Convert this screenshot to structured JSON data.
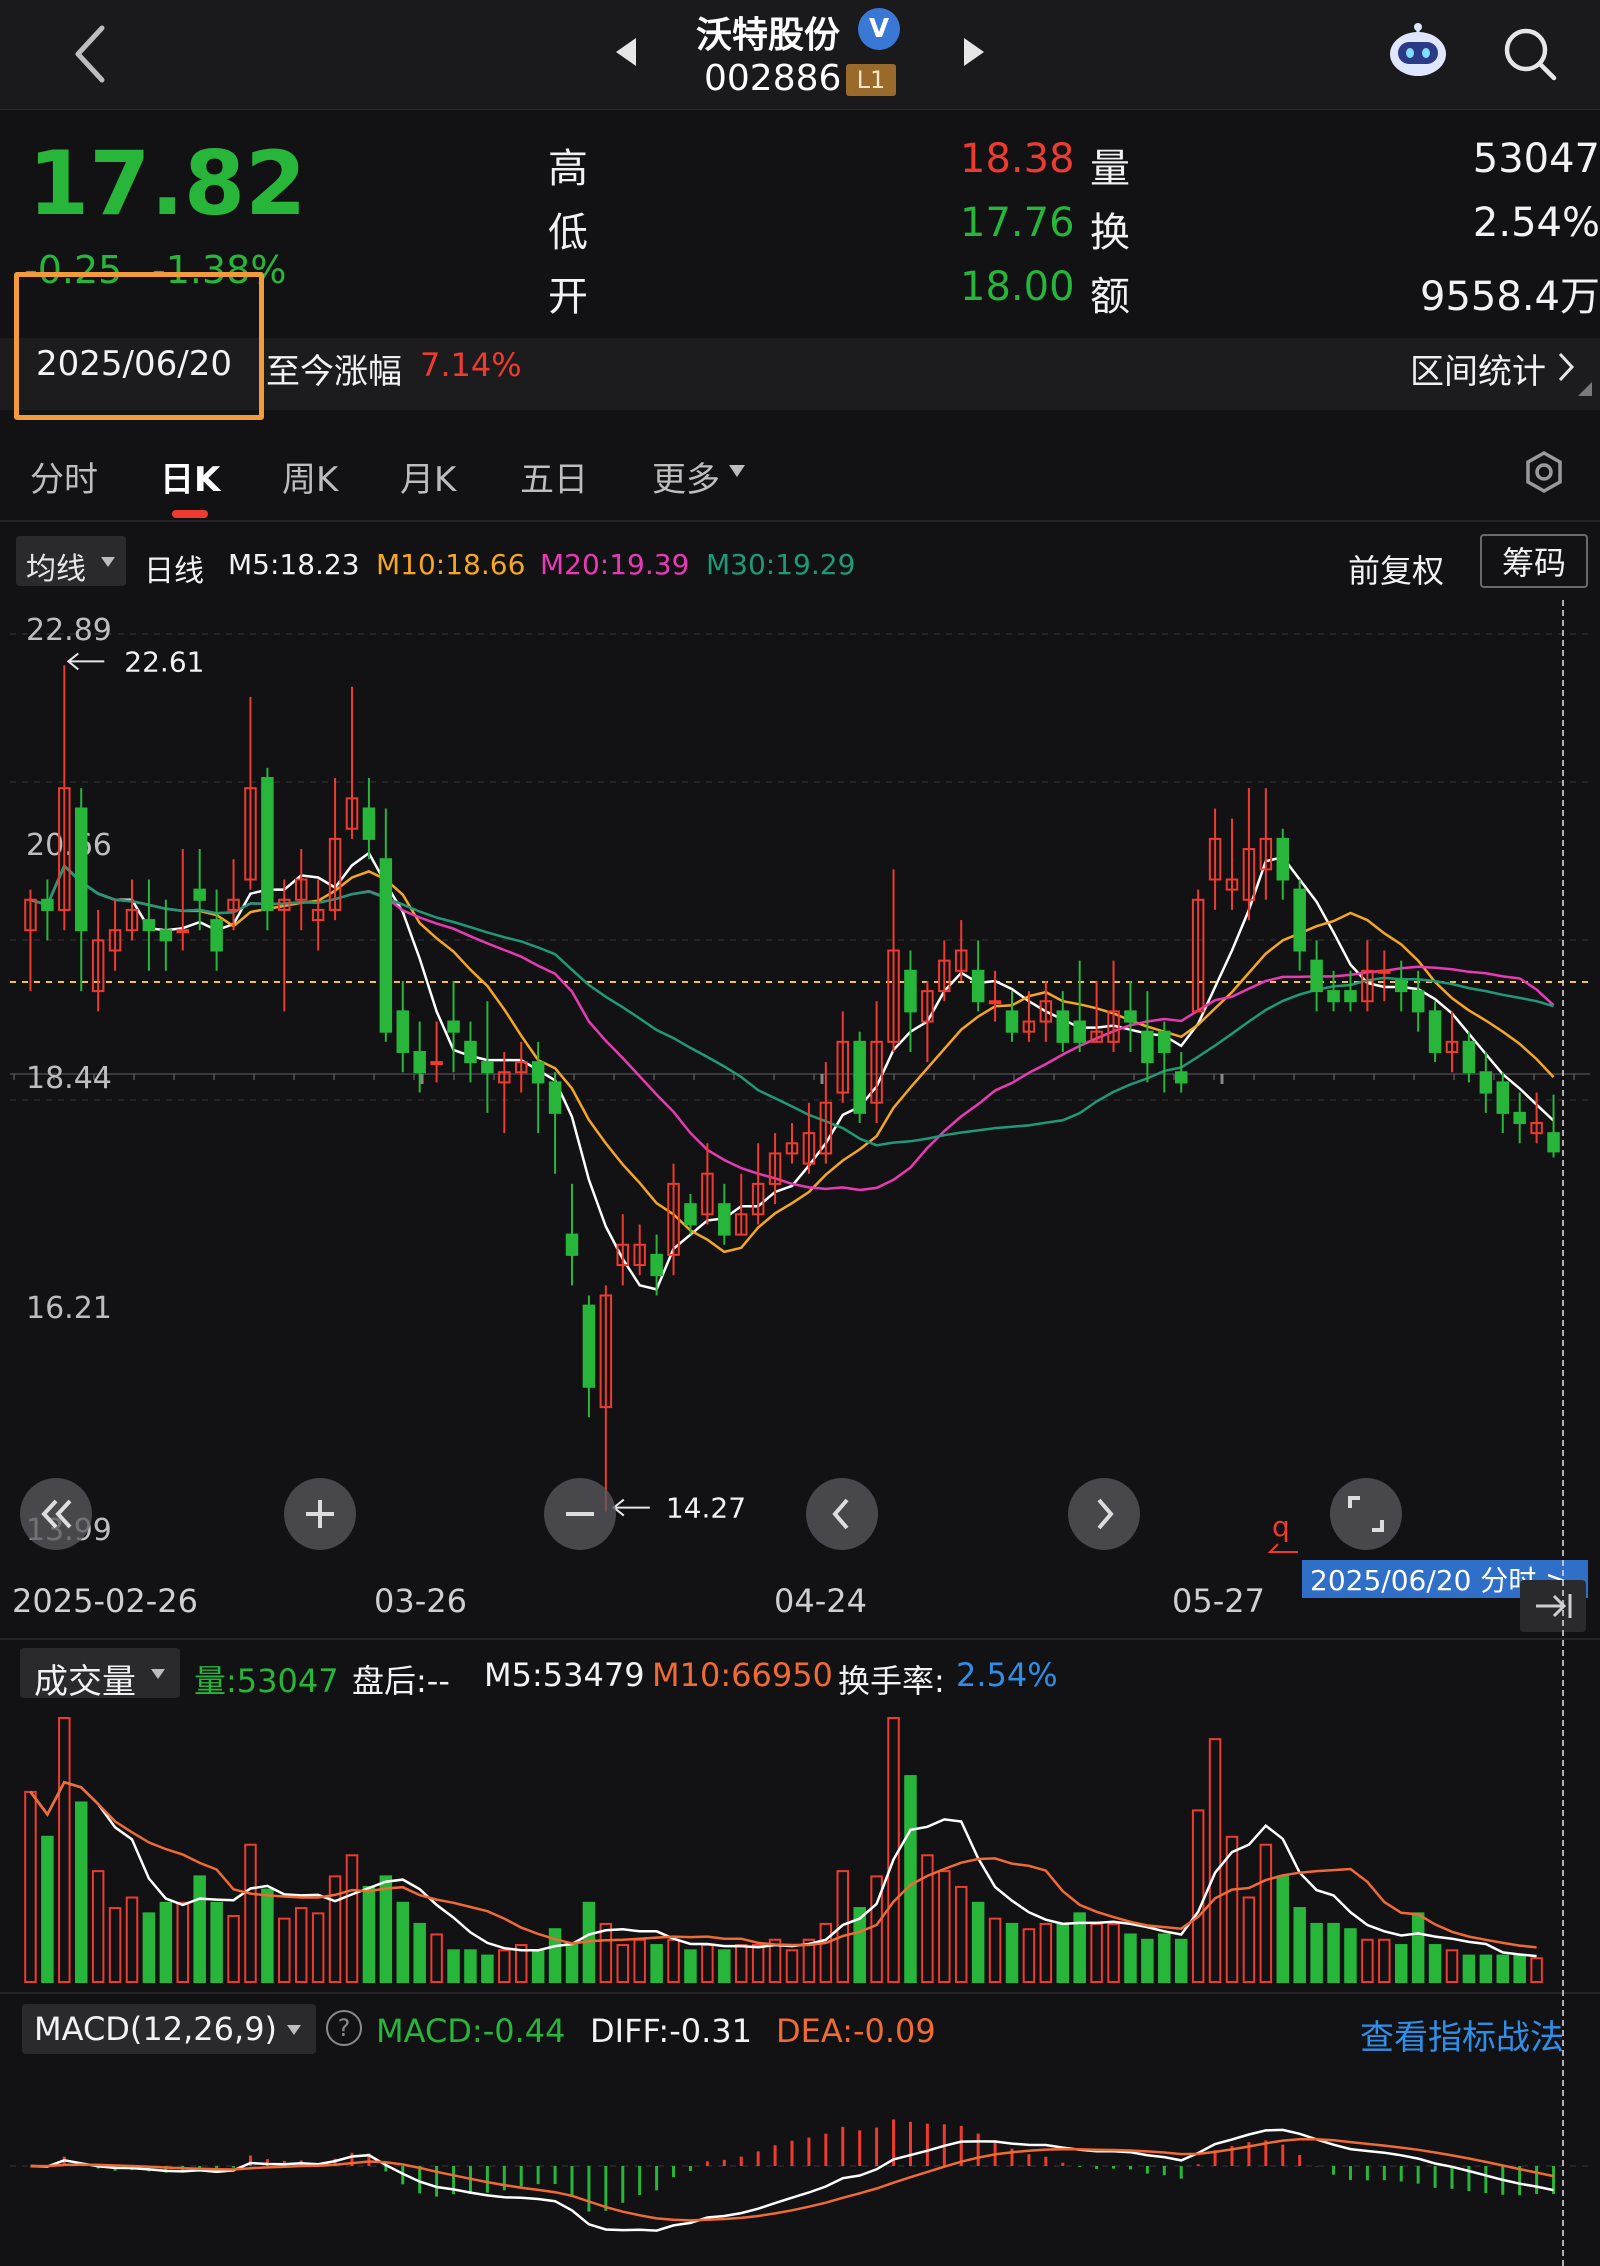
{
  "header": {
    "stock_name": "沃特股份",
    "verified_badge": "V",
    "stock_code": "002886",
    "level_badge": "L1"
  },
  "quote": {
    "price": "17.82",
    "change": "-0.25",
    "change_pct": "-1.38%",
    "high_label": "高",
    "high_value": "18.38",
    "low_label": "低",
    "low_value": "17.76",
    "open_label": "开",
    "open_value": "18.00",
    "volume_label": "量",
    "volume_value": "53047",
    "turnover_label": "换",
    "turnover_value": "2.54%",
    "amount_label": "额",
    "amount_value": "9558.4万"
  },
  "range_bar": {
    "date": "2025/06/20",
    "since_label": "至今涨幅",
    "since_value": "7.14%",
    "stats_label": "区间统计"
  },
  "tabs": [
    {
      "label": "分时"
    },
    {
      "label": "日K"
    },
    {
      "label": "周K"
    },
    {
      "label": "月K"
    },
    {
      "label": "五日"
    },
    {
      "label": "更多"
    }
  ],
  "ma_bar": {
    "selector": "均线",
    "period": "日线",
    "m5": "M5:18.23",
    "m10": "M10:18.66",
    "m20": "M20:19.39",
    "m30": "M30:19.29",
    "adjust": "前复权",
    "chips": "筹码"
  },
  "kline": {
    "price_labels": [
      "22.89",
      "20.66",
      "18.44",
      "16.21",
      "13.99"
    ],
    "max_marker": "22.61",
    "min_marker": "14.27",
    "date_labels": [
      "2025-02-26",
      "03-26",
      "04-24",
      "05-27"
    ],
    "cursor_label": "2025/06/20  分时  >",
    "q_marker": "q"
  },
  "volume_bar": {
    "selector": "成交量",
    "vol": "量:53047",
    "after_hours": "盘后:--",
    "m5": "M5:53479",
    "m10": "M10:66950",
    "turnover": "换手率:",
    "turnover_value": "2.54%"
  },
  "macd_bar": {
    "selector": "MACD(12,26,9)",
    "help": "?",
    "macd": "MACD:-0.44",
    "diff": "DIFF:-0.31",
    "dea": "DEA:-0.09",
    "strategy": "查看指标战法"
  },
  "colors": {
    "up": "#ee3b30",
    "down": "#27b53a",
    "ma5": "#ffffff",
    "ma10": "#f5a623",
    "ma20": "#e83ab5",
    "ma30": "#1e9a78",
    "accent_blue": "#2f8fe8",
    "highlight_box": "#f39a3c"
  },
  "chart_data": [
    {
      "type": "candlestick",
      "title": "沃特股份 002886 日K",
      "x_start": "2025-02-26",
      "x_end": "2025-06-20",
      "ylim": [
        13.99,
        22.89
      ],
      "candles": [
        [
          20.0,
          20.3,
          20.4,
          19.4
        ],
        [
          20.3,
          20.2,
          20.5,
          19.9
        ],
        [
          20.2,
          21.4,
          22.61,
          20.0
        ],
        [
          21.2,
          20.0,
          21.4,
          19.4
        ],
        [
          19.4,
          19.9,
          20.2,
          19.2
        ],
        [
          19.8,
          20.0,
          20.3,
          19.6
        ],
        [
          20.0,
          20.2,
          20.5,
          19.9
        ],
        [
          20.1,
          20.0,
          20.5,
          19.6
        ],
        [
          20.0,
          19.9,
          20.3,
          19.6
        ],
        [
          20.0,
          20.0,
          20.8,
          19.8
        ],
        [
          20.4,
          20.3,
          20.8,
          20.0
        ],
        [
          20.1,
          19.8,
          20.4,
          19.6
        ],
        [
          20.2,
          20.3,
          20.7,
          20.0
        ],
        [
          20.5,
          21.4,
          22.3,
          20.4
        ],
        [
          21.5,
          20.2,
          21.6,
          20.0
        ],
        [
          20.2,
          20.3,
          20.5,
          19.2
        ],
        [
          20.3,
          20.5,
          20.8,
          20.0
        ],
        [
          20.1,
          20.2,
          20.5,
          19.8
        ],
        [
          20.2,
          20.9,
          21.5,
          20.1
        ],
        [
          21.0,
          21.3,
          22.4,
          20.9
        ],
        [
          21.2,
          20.9,
          21.5,
          20.7
        ],
        [
          20.7,
          19.0,
          21.2,
          18.9
        ],
        [
          19.2,
          18.8,
          19.5,
          18.6
        ],
        [
          18.8,
          18.6,
          19.1,
          18.4
        ],
        [
          18.7,
          18.7,
          19.1,
          18.5
        ],
        [
          19.1,
          19.0,
          19.5,
          18.6
        ],
        [
          18.9,
          18.7,
          19.1,
          18.5
        ],
        [
          18.7,
          18.6,
          19.3,
          18.2
        ],
        [
          18.5,
          18.6,
          18.8,
          18.0
        ],
        [
          18.6,
          18.7,
          18.9,
          18.4
        ],
        [
          18.7,
          18.5,
          18.9,
          18.0
        ],
        [
          18.5,
          18.2,
          18.6,
          17.6
        ],
        [
          17.0,
          16.8,
          17.5,
          16.5
        ],
        [
          16.3,
          15.5,
          16.4,
          15.2
        ],
        [
          15.3,
          16.4,
          16.5,
          14.27
        ],
        [
          16.7,
          16.9,
          17.2,
          16.5
        ],
        [
          16.7,
          16.9,
          17.1,
          16.6
        ],
        [
          16.8,
          16.6,
          17.0,
          16.4
        ],
        [
          16.8,
          17.5,
          17.7,
          16.6
        ],
        [
          17.3,
          17.1,
          17.4,
          17.0
        ],
        [
          17.2,
          17.6,
          17.9,
          17.1
        ],
        [
          17.3,
          17.0,
          17.5,
          16.9
        ],
        [
          17.0,
          17.2,
          17.6,
          17.0
        ],
        [
          17.2,
          17.5,
          17.9,
          17.1
        ],
        [
          17.5,
          17.8,
          18.0,
          17.3
        ],
        [
          17.8,
          17.9,
          18.1,
          17.7
        ],
        [
          17.7,
          18.0,
          18.3,
          17.6
        ],
        [
          17.8,
          18.3,
          18.7,
          17.7
        ],
        [
          18.4,
          18.9,
          19.2,
          18.3
        ],
        [
          18.9,
          18.2,
          19.0,
          18.1
        ],
        [
          18.3,
          18.9,
          19.3,
          18.1
        ],
        [
          18.9,
          19.8,
          20.6,
          18.8
        ],
        [
          19.6,
          19.2,
          19.8,
          18.8
        ],
        [
          19.1,
          19.4,
          19.5,
          18.7
        ],
        [
          19.4,
          19.7,
          19.9,
          19.3
        ],
        [
          19.6,
          19.8,
          20.1,
          19.5
        ],
        [
          19.6,
          19.3,
          19.9,
          19.2
        ],
        [
          19.3,
          19.3,
          19.6,
          19.1
        ],
        [
          19.2,
          19.0,
          19.4,
          18.9
        ],
        [
          19.0,
          19.1,
          19.4,
          18.9
        ],
        [
          19.1,
          19.3,
          19.5,
          18.9
        ],
        [
          19.2,
          18.9,
          19.4,
          18.8
        ],
        [
          19.1,
          18.9,
          19.7,
          18.8
        ],
        [
          18.9,
          19.0,
          19.5,
          18.9
        ],
        [
          18.9,
          19.2,
          19.7,
          18.8
        ],
        [
          19.2,
          19.1,
          19.5,
          18.8
        ],
        [
          19.0,
          18.7,
          19.4,
          18.5
        ],
        [
          19.0,
          18.8,
          19.1,
          18.4
        ],
        [
          18.6,
          18.5,
          18.8,
          18.4
        ],
        [
          19.2,
          20.3,
          20.4,
          19.2
        ],
        [
          20.5,
          20.9,
          21.2,
          20.2
        ],
        [
          20.4,
          20.5,
          21.1,
          20.2
        ],
        [
          20.3,
          20.8,
          21.4,
          20.1
        ],
        [
          20.6,
          20.9,
          21.4,
          20.3
        ],
        [
          20.9,
          20.5,
          21.0,
          20.3
        ],
        [
          20.4,
          19.8,
          20.5,
          19.6
        ],
        [
          19.7,
          19.4,
          19.9,
          19.2
        ],
        [
          19.4,
          19.3,
          19.6,
          19.2
        ],
        [
          19.4,
          19.3,
          19.6,
          19.2
        ],
        [
          19.3,
          19.6,
          19.9,
          19.2
        ],
        [
          19.6,
          19.6,
          19.8,
          19.3
        ],
        [
          19.5,
          19.4,
          19.7,
          19.2
        ],
        [
          19.4,
          19.2,
          19.6,
          19.0
        ],
        [
          19.2,
          18.8,
          19.3,
          18.7
        ],
        [
          18.8,
          18.9,
          19.2,
          18.6
        ],
        [
          18.9,
          18.6,
          19.0,
          18.5
        ],
        [
          18.6,
          18.4,
          18.8,
          18.2
        ],
        [
          18.5,
          18.2,
          18.6,
          18.0
        ],
        [
          18.2,
          18.1,
          18.4,
          17.9
        ],
        [
          18.0,
          18.1,
          18.4,
          17.9
        ],
        [
          18.0,
          17.82,
          18.38,
          17.76
        ]
      ]
    },
    {
      "type": "bar",
      "title": "成交量",
      "note": "volume bars, red=up day, green=down day",
      "values": [
        72,
        55,
        100,
        68,
        42,
        28,
        32,
        26,
        30,
        30,
        40,
        30,
        25,
        52,
        35,
        24,
        28,
        26,
        40,
        48,
        36,
        40,
        30,
        22,
        18,
        12,
        12,
        10,
        12,
        14,
        12,
        20,
        14,
        30,
        22,
        14,
        16,
        14,
        16,
        12,
        14,
        12,
        14,
        14,
        16,
        12,
        16,
        22,
        42,
        28,
        40,
        100,
        78,
        48,
        42,
        36,
        30,
        24,
        22,
        20,
        22,
        22,
        26,
        22,
        22,
        18,
        16,
        18,
        16,
        65,
        92,
        55,
        32,
        52,
        40,
        28,
        22,
        22,
        20,
        16,
        16,
        14,
        26,
        14,
        12,
        10,
        10,
        10,
        10,
        9
      ]
    },
    {
      "type": "bar",
      "title": "MACD(12,26,9)",
      "note": "MACD histogram values (MACD:-0.44, DIFF:-0.31, DEA:-0.09)"
    }
  ]
}
